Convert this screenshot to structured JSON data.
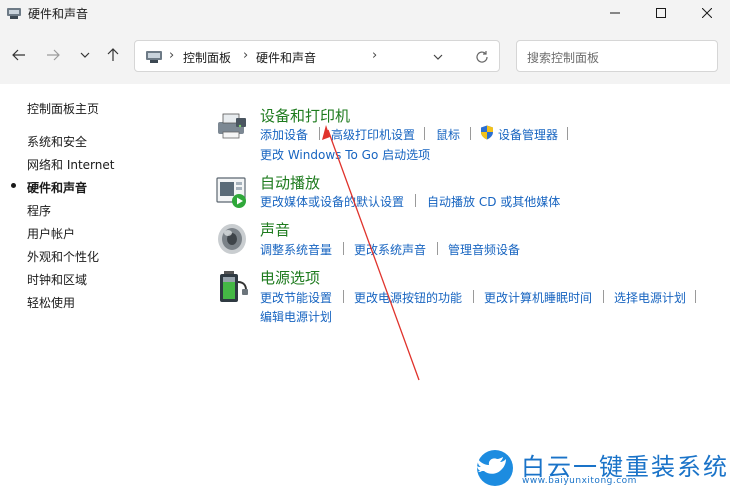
{
  "window": {
    "title": "硬件和声音",
    "icon": "control-panel-icon"
  },
  "navigation": {
    "breadcrumbs": [
      "控制面板",
      "硬件和声音"
    ],
    "search_placeholder": "搜索控制面板"
  },
  "sidebar": {
    "items": [
      {
        "label": "控制面板主页",
        "active": false
      },
      {
        "label": "系统和安全",
        "active": false
      },
      {
        "label": "网络和 Internet",
        "active": false
      },
      {
        "label": "硬件和声音",
        "active": true
      },
      {
        "label": "程序",
        "active": false
      },
      {
        "label": "用户帐户",
        "active": false
      },
      {
        "label": "外观和个性化",
        "active": false
      },
      {
        "label": "时钟和区域",
        "active": false
      },
      {
        "label": "轻松使用",
        "active": false
      }
    ]
  },
  "categories": [
    {
      "title": "设备和打印机",
      "icon": "printer-icon",
      "links": [
        "添加设备",
        "高级打印机设置",
        "鼠标",
        "设备管理器",
        "更改 Windows To Go 启动选项"
      ]
    },
    {
      "title": "自动播放",
      "icon": "autoplay-icon",
      "links": [
        "更改媒体或设备的默认设置",
        "自动播放 CD 或其他媒体"
      ]
    },
    {
      "title": "声音",
      "icon": "speaker-icon",
      "links": [
        "调整系统音量",
        "更改系统声音",
        "管理音频设备"
      ]
    },
    {
      "title": "电源选项",
      "icon": "battery-icon",
      "links": [
        "更改节能设置",
        "更改电源按钮的功能",
        "更改计算机睡眠时间",
        "选择电源计划",
        "编辑电源计划"
      ]
    }
  ],
  "watermark": {
    "text": "白云一键重装系统",
    "url": "www.baiyunxitong.com"
  },
  "colors": {
    "category_title": "#1e7b1e",
    "link": "#1764c0",
    "annotation_arrow": "#e0332c",
    "watermark": "#1a73c8"
  }
}
